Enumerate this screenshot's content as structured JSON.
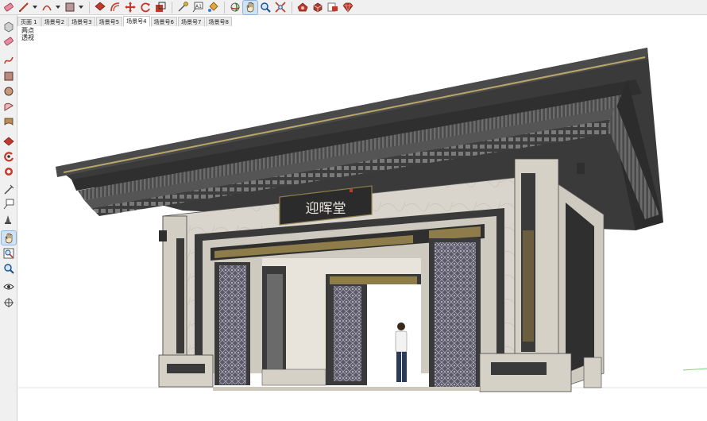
{
  "toolbar": {
    "tools": [
      {
        "icon": "eraser-icon"
      },
      {
        "icon": "pencil-line-icon"
      },
      {
        "icon": "arc-icon"
      },
      {
        "icon": "rectangle-icon"
      },
      {
        "icon": "push-pull-icon"
      },
      {
        "icon": "offset-icon"
      },
      {
        "icon": "move-icon"
      },
      {
        "icon": "rotate-icon"
      },
      {
        "icon": "scale-icon"
      },
      {
        "icon": "tape-measure-icon"
      },
      {
        "icon": "text-icon"
      },
      {
        "icon": "paint-bucket-icon"
      },
      {
        "icon": "orbit-icon"
      },
      {
        "icon": "pan-icon"
      },
      {
        "icon": "zoom-icon"
      },
      {
        "icon": "zoom-extents-icon"
      },
      {
        "icon": "warehouse-icon"
      },
      {
        "icon": "extension-icon"
      },
      {
        "icon": "share-model-icon"
      },
      {
        "icon": "ruby-icon"
      }
    ],
    "text_tool_label": "A1"
  },
  "scene_tabs": [
    "页面 1",
    "场景号2",
    "场景号3",
    "场景号5",
    "场景号4",
    "场景号6",
    "场景号7",
    "场景号8"
  ],
  "active_scene": "场景号4",
  "camera": {
    "line1": "两点",
    "line2": "透视"
  },
  "left_tools": [
    "select-icon",
    "eraser-icon",
    "freehand-icon",
    "rectangle-icon",
    "polygon-icon",
    "arc-icon",
    "tape-icon",
    "push-pull-icon",
    "follow-me-icon",
    "offset-icon",
    "tape-measure-icon",
    "text-icon",
    "axes-icon",
    "pan-icon",
    "zoom-window-icon",
    "zoom-icon",
    "look-around-icon",
    "walk-icon"
  ],
  "model": {
    "plaque_text": "迎晖堂"
  },
  "colors": {
    "roof": "#3b3b3b",
    "stone": "#d9d5cc",
    "dark_frame": "#2f2f2f",
    "screen": "#5a5a6e",
    "accent": "#b9a66a"
  }
}
